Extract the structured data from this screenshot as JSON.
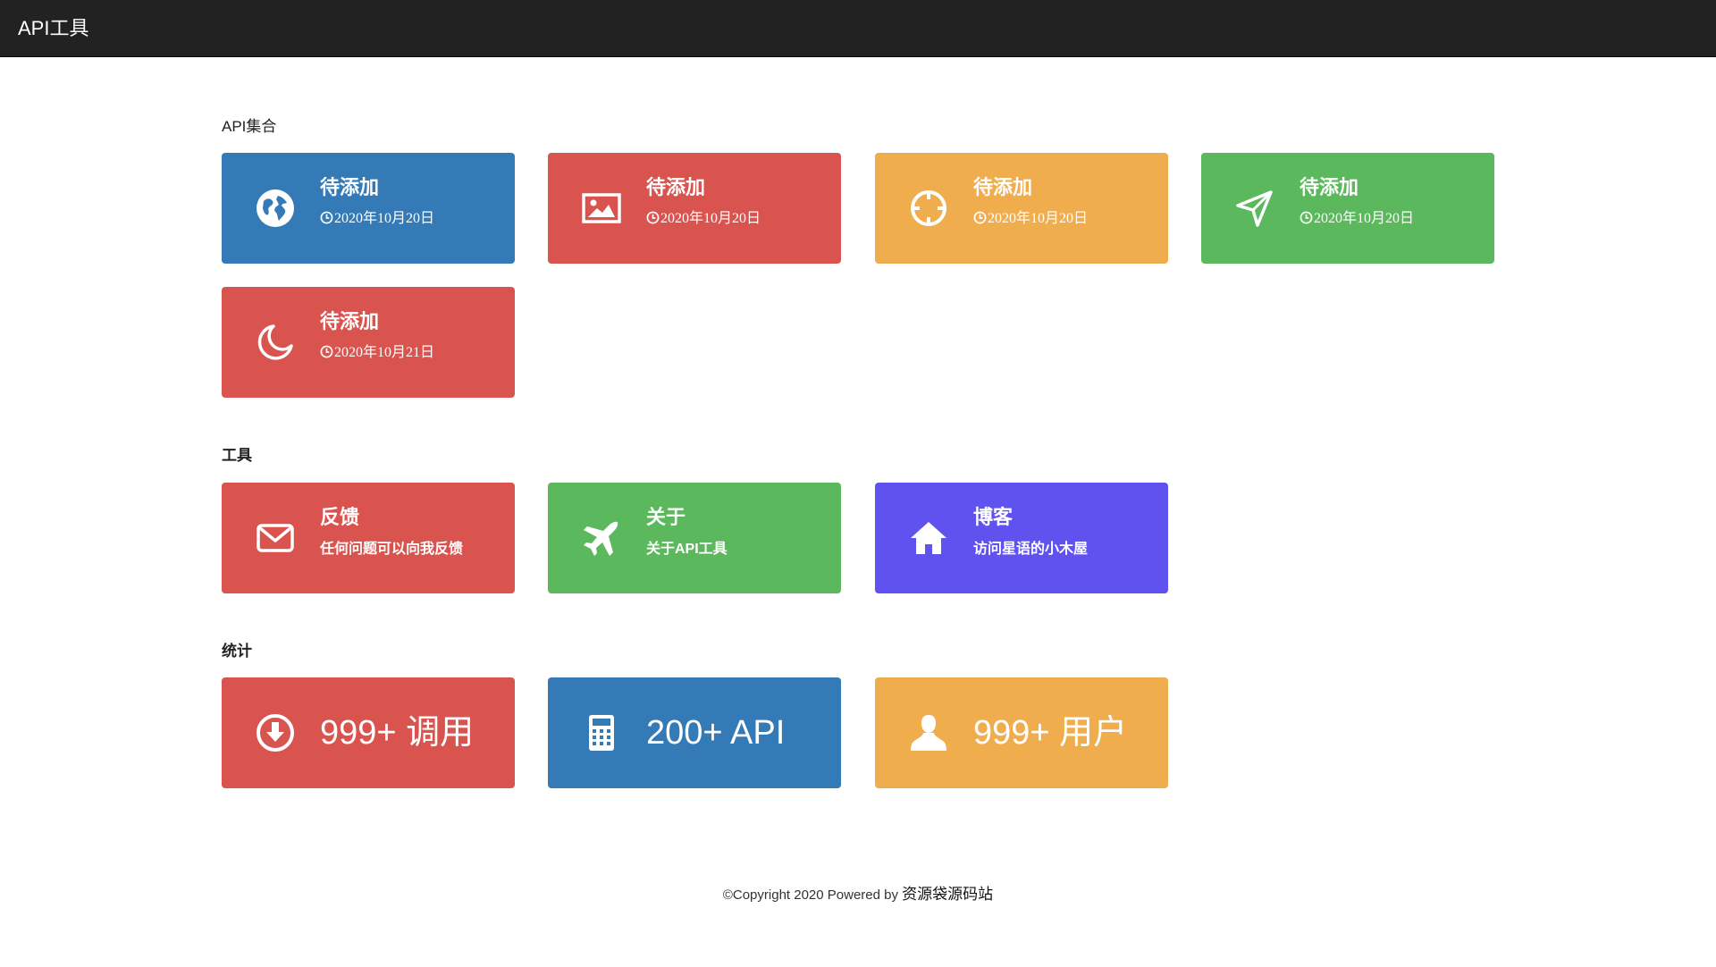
{
  "navbar": {
    "brand": "API工具"
  },
  "sections": {
    "api": {
      "title": "API集合",
      "cards": [
        {
          "title": "待添加",
          "date": "2020年10月20日",
          "icon": "globe-icon",
          "color": "#337ab7"
        },
        {
          "title": "待添加",
          "date": "2020年10月20日",
          "icon": "picture-icon",
          "color": "#d9534f"
        },
        {
          "title": "待添加",
          "date": "2020年10月20日",
          "icon": "crosshair-icon",
          "color": "#f0ad4e"
        },
        {
          "title": "待添加",
          "date": "2020年10月20日",
          "icon": "send-icon",
          "color": "#5cb85c"
        },
        {
          "title": "待添加",
          "date": "2020年10月21日",
          "icon": "moon-icon",
          "color": "#d9534f"
        }
      ]
    },
    "tools": {
      "title": "工具",
      "cards": [
        {
          "title": "反馈",
          "desc": "任何问题可以向我反馈",
          "icon": "envelope-icon",
          "color": "#d9534f"
        },
        {
          "title": "关于",
          "desc": "关于API工具",
          "icon": "plane-icon",
          "color": "#5cb85c"
        },
        {
          "title": "博客",
          "desc": "访问星语的小木屋",
          "icon": "home-icon",
          "color": "#5f52ef"
        }
      ]
    },
    "stats": {
      "title": "统计",
      "cards": [
        {
          "text": "999+ 调用",
          "icon": "download-circle-icon",
          "color": "#d9534f"
        },
        {
          "text": "200+ API",
          "icon": "calculator-icon",
          "color": "#337ab7"
        },
        {
          "text": "999+ 用户",
          "icon": "user-icon",
          "color": "#f0ad4e"
        }
      ]
    }
  },
  "footer": {
    "text": "©Copyright 2020 Powered by ",
    "site": "资源袋源码站"
  }
}
